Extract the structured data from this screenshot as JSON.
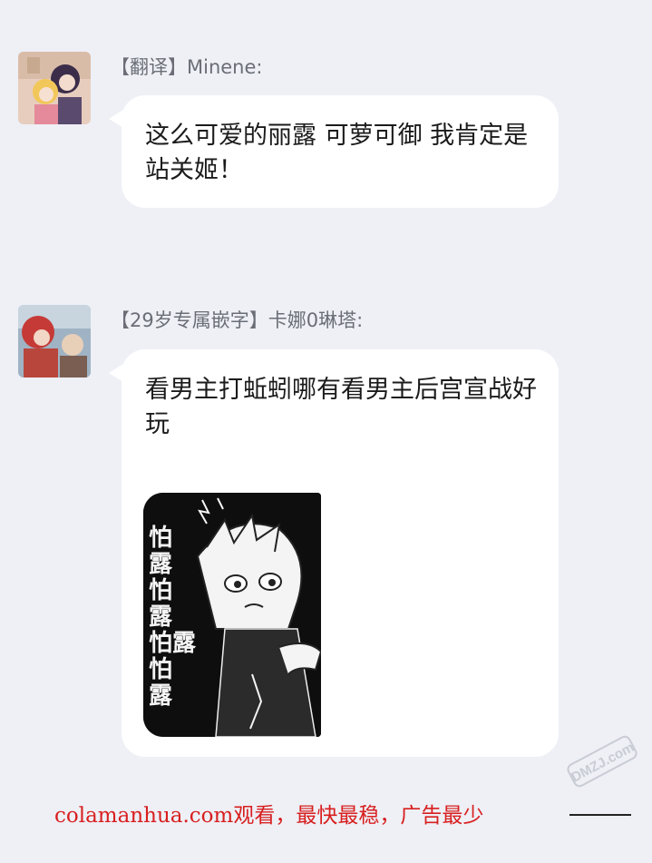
{
  "messages": [
    {
      "sender": "【翻译】Minene:",
      "text": "这么可爱的丽露 可萝可御 我肯定是站关姬！"
    },
    {
      "sender": "【29岁专属嵌字】卡娜0琳塔:",
      "text": "看男主打蚯蚓哪有看男主后宫宣战好玩",
      "sticker_text": [
        "怕",
        "露",
        "怕",
        "露",
        "怕露",
        "怕",
        "露",
        "怕",
        "露",
        "怕",
        "露"
      ]
    }
  ],
  "watermark": {
    "text": "colamanhua.com观看，最快最稳，广告最少",
    "logo_text": "DMZJ.com"
  },
  "colors": {
    "background": "#eef0f6",
    "bubble": "#ffffff",
    "sender": "#6b6e76",
    "watermark": "#d81f1f"
  }
}
